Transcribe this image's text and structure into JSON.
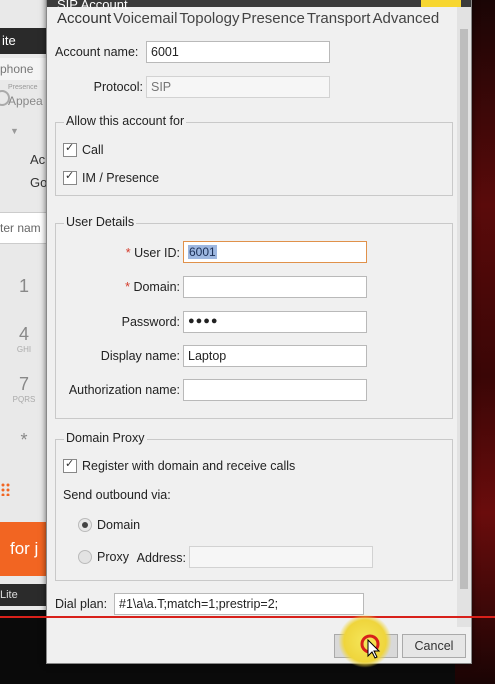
{
  "dialog": {
    "title": "SIP Account",
    "tabs": [
      "Account",
      "Voicemail",
      "Topology",
      "Presence",
      "Transport",
      "Advanced"
    ]
  },
  "account": {
    "account_name_label": "Account name:",
    "account_name_value": "6001",
    "protocol_label": "Protocol:",
    "protocol_placeholder": "SIP"
  },
  "allow": {
    "legend": "Allow this account for",
    "call_label": "Call",
    "call_checked": true,
    "im_label": "IM / Presence",
    "im_checked": true
  },
  "user_details": {
    "legend": "User Details",
    "required_marker": "*",
    "user_id_label": "User ID:",
    "user_id_value": "6001",
    "domain_label": "Domain:",
    "domain_value": "",
    "password_label": "Password:",
    "password_value": "●●●●",
    "display_name_label": "Display name:",
    "display_name_value": "Laptop",
    "auth_name_label": "Authorization name:",
    "auth_name_value": ""
  },
  "domain_proxy": {
    "legend": "Domain Proxy",
    "register_label": "Register with domain and receive calls",
    "register_checked": true,
    "send_outbound_label": "Send outbound via:",
    "domain_option": "Domain",
    "proxy_option": "Proxy",
    "address_label": "Address:",
    "address_value": "",
    "selected": "Domain"
  },
  "dial_plan": {
    "label": "Dial plan:",
    "value": "#1\\a\\a.T;match=1;prestrip=2;"
  },
  "buttons": {
    "ok_label": "OK",
    "cancel_label": "Cancel"
  },
  "background_app": {
    "title_fragment": "ite",
    "phone_fragment": "phone",
    "presence_small": "Presence",
    "presence_fragment": "Appea",
    "ac_fragment": "Ac",
    "go_fragment": "Go",
    "search_fragment": "ter nam",
    "keys": [
      {
        "n": "1",
        "l": ""
      },
      {
        "n": "4",
        "l": "GHI"
      },
      {
        "n": "7",
        "l": "PQRS"
      },
      {
        "n": "*",
        "l": ""
      }
    ],
    "promo_fragment": "for j",
    "footer_fragment": "Lite"
  },
  "colors": {
    "accent_orange": "#f26522",
    "required_red": "#d43a2a",
    "focus_border": "#e0914a",
    "red_line": "#d8201a"
  }
}
